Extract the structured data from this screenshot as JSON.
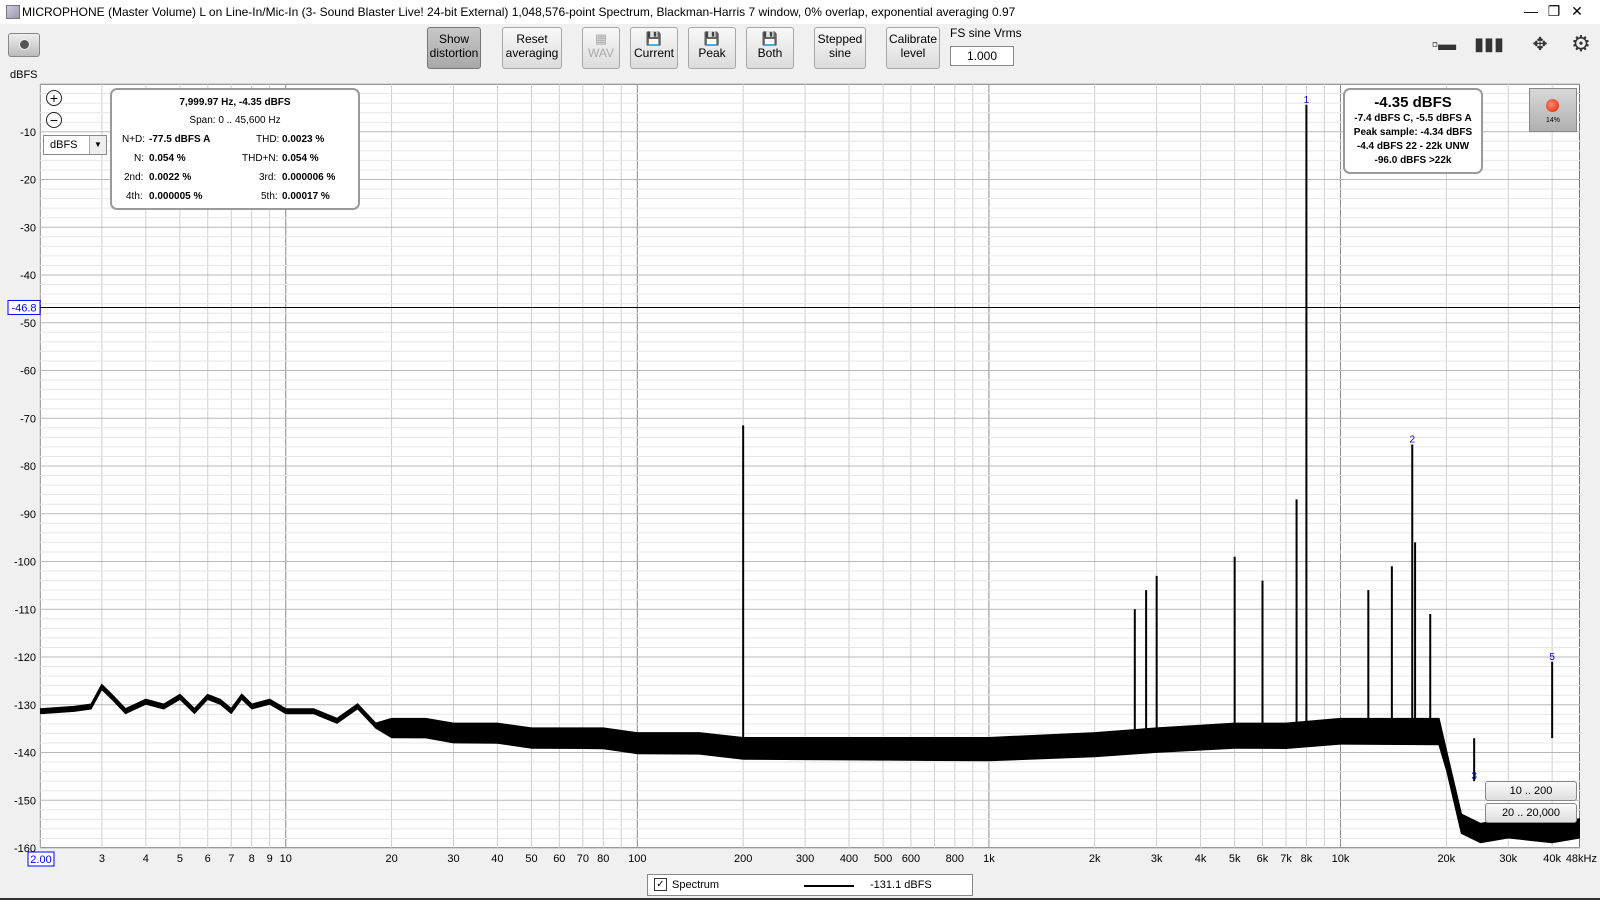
{
  "window": {
    "title": "MICROPHONE (Master Volume) L on Line-In/Mic-In (3- Sound Blaster Live! 24-bit External) 1,048,576-point Spectrum, Blackman-Harris 7 window, 0% overlap, exponential averaging 0.97",
    "minimize": "—",
    "maximize": "❐",
    "close": "✕"
  },
  "toolbar": {
    "show_distortion": [
      "Show",
      "distortion"
    ],
    "reset_averaging": [
      "Reset",
      "averaging"
    ],
    "wav": "WAV",
    "current": "Current",
    "peak": "Peak",
    "both": "Both",
    "stepped_sine": [
      "Stepped",
      "sine"
    ],
    "calibrate_level": [
      "Calibrate",
      "level"
    ],
    "fs_sine_label": "FS sine Vrms",
    "fs_sine_value": "1.000"
  },
  "plot": {
    "unit_label": "dBFS",
    "unit_select": "dBFS",
    "cursor_level": "-46.8",
    "x_start": "2.00",
    "x_end_label": "48kHz"
  },
  "info_box": {
    "cursor": "7,999.97 Hz, -4.35 dBFS",
    "span": "Span: 0 .. 45,600 Hz",
    "nd_label": "N+D:",
    "nd_value": "-77.5 dBFS A",
    "thd_label": "THD:",
    "thd_value": "0.0023 %",
    "n_label": "N:",
    "n_value": "0.054 %",
    "thdn_label": "THD+N:",
    "thdn_value": "0.054 %",
    "h2_label": "2nd:",
    "h2_value": "0.0022 %",
    "h3_label": "3rd:",
    "h3_value": "0.000006 %",
    "h4_label": "4th:",
    "h4_value": "0.000005 %",
    "h5_label": "5th:",
    "h5_value": "0.00017 %"
  },
  "level_box": {
    "main": "-4.35 dBFS",
    "line1": "-7.4 dBFS C, -5.5 dBFS A",
    "line2": "Peak sample: -4.34 dBFS",
    "line3": "-4.4 dBFS 22 - 22k UNW",
    "line4": "-96.0 dBFS >22k"
  },
  "record": {
    "percent": "14%"
  },
  "range_buttons": {
    "low": "10 .. 200",
    "mid": "20 .. 20,000"
  },
  "legend": {
    "checked": "✓",
    "name": "Spectrum",
    "value": "-131.1 dBFS"
  },
  "icons": [
    "camera-icon",
    "zoom-in-icon",
    "zoom-out-icon",
    "save-icon",
    "layout-icon",
    "columns-icon",
    "expand-arrows-icon",
    "gear-icon",
    "record-icon"
  ],
  "chart_data": {
    "type": "line",
    "x_scale": "log",
    "xlim": [
      2,
      48000
    ],
    "ylim": [
      -160,
      0
    ],
    "ylabel": "dBFS",
    "grid": true,
    "y_ticks": [
      -10,
      -20,
      -30,
      -40,
      -50,
      -60,
      -70,
      -80,
      -90,
      -100,
      -110,
      -120,
      -130,
      -140,
      -150,
      -160
    ],
    "x_ticks": [
      {
        "v": 3,
        "l": "3"
      },
      {
        "v": 4,
        "l": "4"
      },
      {
        "v": 5,
        "l": "5"
      },
      {
        "v": 6,
        "l": "6"
      },
      {
        "v": 7,
        "l": "7"
      },
      {
        "v": 8,
        "l": "8"
      },
      {
        "v": 9,
        "l": "9"
      },
      {
        "v": 10,
        "l": "10"
      },
      {
        "v": 20,
        "l": "20"
      },
      {
        "v": 30,
        "l": "30"
      },
      {
        "v": 40,
        "l": "40"
      },
      {
        "v": 50,
        "l": "50"
      },
      {
        "v": 60,
        "l": "60"
      },
      {
        "v": 70,
        "l": "70"
      },
      {
        "v": 80,
        "l": "80"
      },
      {
        "v": 100,
        "l": "100"
      },
      {
        "v": 200,
        "l": "200"
      },
      {
        "v": 300,
        "l": "300"
      },
      {
        "v": 400,
        "l": "400"
      },
      {
        "v": 500,
        "l": "500"
      },
      {
        "v": 600,
        "l": "600"
      },
      {
        "v": 800,
        "l": "800"
      },
      {
        "v": 1000,
        "l": "1k"
      },
      {
        "v": 2000,
        "l": "2k"
      },
      {
        "v": 3000,
        "l": "3k"
      },
      {
        "v": 4000,
        "l": "4k"
      },
      {
        "v": 5000,
        "l": "5k"
      },
      {
        "v": 6000,
        "l": "6k"
      },
      {
        "v": 7000,
        "l": "7k"
      },
      {
        "v": 8000,
        "l": "8k"
      },
      {
        "v": 10000,
        "l": "10k"
      },
      {
        "v": 20000,
        "l": "20k"
      },
      {
        "v": 30000,
        "l": "30k"
      },
      {
        "v": 40000,
        "l": "40k"
      }
    ],
    "cursor_hline": -46.8,
    "series": [
      {
        "points": [
          [
            2,
            -131
          ],
          [
            2.5,
            -130.5
          ],
          [
            2.8,
            -130
          ],
          [
            3,
            -126
          ],
          [
            3.2,
            -128
          ],
          [
            3.5,
            -131
          ],
          [
            4,
            -129
          ],
          [
            4.5,
            -130
          ],
          [
            5,
            -128
          ],
          [
            5.5,
            -131
          ],
          [
            6,
            -128
          ],
          [
            6.5,
            -129
          ],
          [
            7,
            -131
          ],
          [
            7.5,
            -128
          ],
          [
            8,
            -130
          ],
          [
            9,
            -129
          ],
          [
            10,
            -131
          ],
          [
            12,
            -131
          ],
          [
            14,
            -133
          ],
          [
            16,
            -130
          ],
          [
            18,
            -134
          ],
          [
            20,
            -133
          ],
          [
            25,
            -133
          ],
          [
            30,
            -134
          ],
          [
            40,
            -134
          ],
          [
            50,
            -135
          ],
          [
            60,
            -135
          ],
          [
            70,
            -135
          ],
          [
            80,
            -135
          ],
          [
            100,
            -136
          ],
          [
            150,
            -136
          ],
          [
            200,
            -137
          ],
          [
            300,
            -137
          ],
          [
            400,
            -137
          ],
          [
            500,
            -137
          ],
          [
            700,
            -137
          ],
          [
            1000,
            -137
          ],
          [
            2000,
            -136
          ],
          [
            3000,
            -135
          ],
          [
            5000,
            -134
          ],
          [
            7000,
            -134
          ],
          [
            10000,
            -133
          ],
          [
            15000,
            -133
          ],
          [
            19000,
            -133
          ],
          [
            20000,
            -140
          ],
          [
            22000,
            -153
          ],
          [
            25000,
            -155
          ],
          [
            30000,
            -154
          ],
          [
            40000,
            -155
          ],
          [
            48000,
            -154
          ]
        ]
      }
    ],
    "peaks": [
      {
        "x": 200,
        "y": -71.5
      },
      {
        "x": 8000,
        "y": -4.35,
        "label": "1"
      },
      {
        "x": 16000,
        "y": -75.5,
        "label": "2"
      },
      {
        "x": 24000,
        "y": -146,
        "label": "3"
      },
      {
        "x": 40000,
        "y": -121,
        "label": "5"
      },
      {
        "x": 7500,
        "y": -87
      },
      {
        "x": 16300,
        "y": -96
      },
      {
        "x": 2600,
        "y": -110
      },
      {
        "x": 2800,
        "y": -106
      },
      {
        "x": 3000,
        "y": -103
      },
      {
        "x": 5000,
        "y": -99
      },
      {
        "x": 6000,
        "y": -104
      },
      {
        "x": 12000,
        "y": -106
      },
      {
        "x": 14000,
        "y": -101
      },
      {
        "x": 18000,
        "y": -111
      }
    ]
  }
}
